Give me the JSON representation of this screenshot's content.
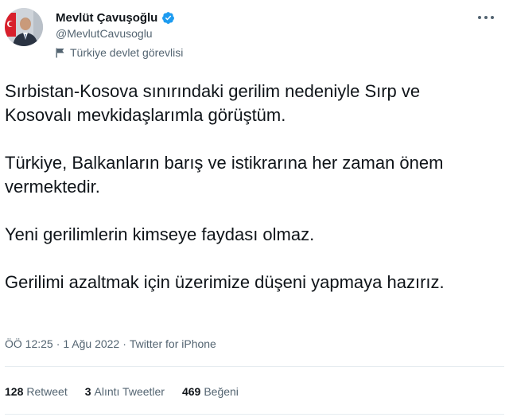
{
  "author": {
    "display_name": "Mevlüt Çavuşoğlu",
    "handle": "@MevlutCavusoglu",
    "gov_label": "Türkiye devlet görevlisi",
    "avatar_icon": "portrait-with-flag",
    "verified_icon": "verified-badge-icon",
    "verified_color": "#1d9bf0"
  },
  "more_icon": "more-dots-icon",
  "tweet": {
    "paragraphs": [
      "Sırbistan-Kosova sınırındaki gerilim nedeniyle Sırp ve Kosovalı mevkidaşlarımla görüştüm.",
      "Türkiye, Balkanların barış ve istikrarına her zaman önem vermektedir.",
      "Yeni gerilimlerin kimseye faydası olmaz.",
      "Gerilimi azaltmak için üzerimize düşeni yapmaya hazırız."
    ]
  },
  "meta": {
    "time": "ÖÖ 12:25",
    "separator": "·",
    "date": "1 Ağu 2022",
    "source": "Twitter for iPhone"
  },
  "stats": {
    "retweets": {
      "count": "128",
      "label": "Retweet"
    },
    "quotes": {
      "count": "3",
      "label": "Alıntı Tweetler"
    },
    "likes": {
      "count": "469",
      "label": "Beğeni"
    }
  },
  "colors": {
    "text": "#0f1419",
    "secondary": "#536471",
    "divider": "#e6ecf0"
  }
}
